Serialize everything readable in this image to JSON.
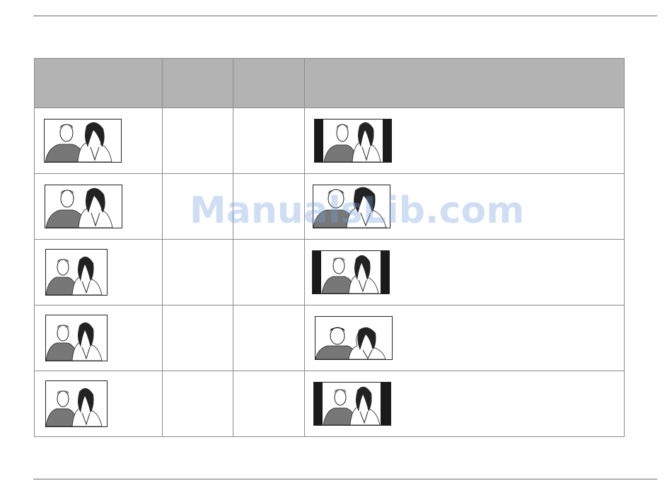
{
  "table": {
    "headers": [
      "",
      "",
      "",
      ""
    ],
    "rows": [
      {
        "source_icon": "widescreen-couple-icon",
        "col2": "",
        "col3": "",
        "result_icon": "pillarbox-couple-icon"
      },
      {
        "source_icon": "widescreen-couple-icon",
        "col2": "",
        "col3": "",
        "result_icon": "stretched-couple-icon"
      },
      {
        "source_icon": "standard-couple-icon",
        "col2": "",
        "col3": "",
        "result_icon": "pillarbox-couple-icon"
      },
      {
        "source_icon": "standard-couple-icon",
        "col2": "",
        "col3": "",
        "result_icon": "zoomed-couple-icon"
      },
      {
        "source_icon": "standard-couple-icon",
        "col2": "",
        "col3": "",
        "result_icon": "pillarbox-couple-icon"
      }
    ]
  },
  "watermark": "ManualsLib.com",
  "colors": {
    "header_bg": "#b3b3b3",
    "rule": "#6e6e6e",
    "shirt": "#777777",
    "bars": "#1a1a1a"
  }
}
